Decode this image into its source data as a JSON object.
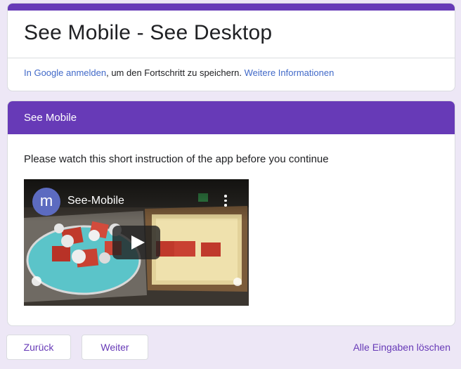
{
  "form": {
    "title": "See Mobile - See Desktop",
    "signin": {
      "link_text": "In Google anmelden",
      "middle_text": ", um den Fortschritt zu speichern.",
      "info_link": "Weitere Informationen"
    }
  },
  "section": {
    "title": "See Mobile",
    "description": "Please watch this short instruction of the app before you continue",
    "video": {
      "channel_initial": "m",
      "title": "See-Mobile"
    }
  },
  "navigation": {
    "back_label": "Zurück",
    "next_label": "Weiter",
    "clear_label": "Alle Eingaben löschen"
  },
  "colors": {
    "accent": "#673ab7",
    "background": "#ede7f6",
    "link": "#4169c8"
  }
}
